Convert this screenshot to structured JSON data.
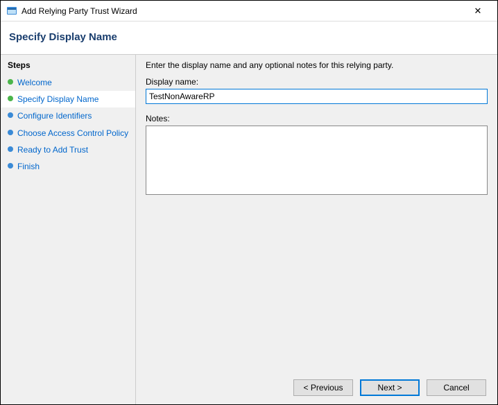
{
  "window": {
    "title": "Add Relying Party Trust Wizard",
    "close_label": "✕"
  },
  "header": {
    "page_title": "Specify Display Name"
  },
  "sidebar": {
    "header": "Steps",
    "items": [
      {
        "label": "Welcome",
        "status": "done"
      },
      {
        "label": "Specify Display Name",
        "status": "done",
        "current": true
      },
      {
        "label": "Configure Identifiers",
        "status": "pending"
      },
      {
        "label": "Choose Access Control Policy",
        "status": "pending"
      },
      {
        "label": "Ready to Add Trust",
        "status": "pending"
      },
      {
        "label": "Finish",
        "status": "pending"
      }
    ]
  },
  "main": {
    "instruction": "Enter the display name and any optional notes for this relying party.",
    "display_name_label": "Display name:",
    "display_name_value": "TestNonAwareRP",
    "notes_label": "Notes:",
    "notes_value": ""
  },
  "buttons": {
    "previous": "< Previous",
    "next": "Next >",
    "cancel": "Cancel"
  }
}
